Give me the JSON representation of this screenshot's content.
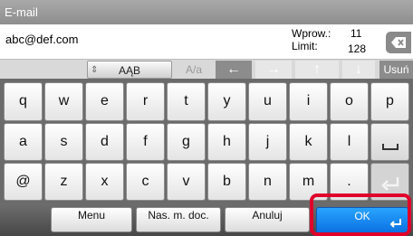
{
  "title": "E-mail",
  "input": {
    "value": "abc@def.com"
  },
  "counter": {
    "entered_label": "Wprow.:",
    "entered_value": "11",
    "limit_label": "Limit:",
    "limit_value": "128"
  },
  "mode_bar": {
    "shift_label": "AĄB",
    "case_label": "A/a",
    "left_arrow": "←",
    "right_arrow": "→",
    "up_arrow": "↑",
    "down_arrow": "↓",
    "delete_label": "Usuń"
  },
  "keyboard": {
    "row1": [
      "q",
      "w",
      "e",
      "r",
      "t",
      "y",
      "u",
      "i",
      "o",
      "p"
    ],
    "row2": [
      "a",
      "s",
      "d",
      "f",
      "g",
      "h",
      "j",
      "k",
      "l"
    ],
    "row3": [
      "@",
      "z",
      "x",
      "c",
      "v",
      "b",
      "n",
      "m",
      "."
    ]
  },
  "bottom_bar": {
    "menu_label": "Menu",
    "domain_label": "Nas. m. doc.",
    "cancel_label": "Anuluj",
    "ok_label": "OK"
  }
}
